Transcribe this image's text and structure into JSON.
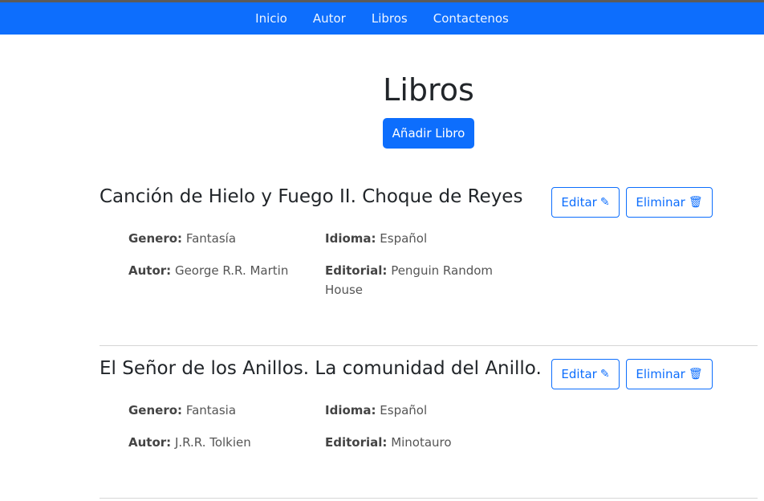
{
  "nav": {
    "items": [
      "Inicio",
      "Autor",
      "Libros",
      "Contactenos"
    ]
  },
  "page": {
    "title": "Libros",
    "add_button": "Añadir Libro"
  },
  "labels": {
    "genero": "Genero:",
    "idioma": "Idioma:",
    "autor": "Autor:",
    "editorial": "Editorial:",
    "edit": "Editar",
    "delete": "Eliminar"
  },
  "icons": {
    "edit": "pencil-icon",
    "delete": "trash-icon"
  },
  "books": [
    {
      "title": "Canción de Hielo y Fuego II. Choque de Reyes",
      "genero": "Fantasía",
      "idioma": "Español",
      "autor": "George R.R. Martin",
      "editorial": "Penguin Random House"
    },
    {
      "title": "El Señor de los Anillos. La comunidad del Anillo.",
      "genero": "Fantasia",
      "idioma": "Español",
      "autor": "J.R.R. Tolkien",
      "editorial": "Minotauro"
    }
  ],
  "colors": {
    "primary": "#0d6efd",
    "divider": "#d6d6d6"
  }
}
